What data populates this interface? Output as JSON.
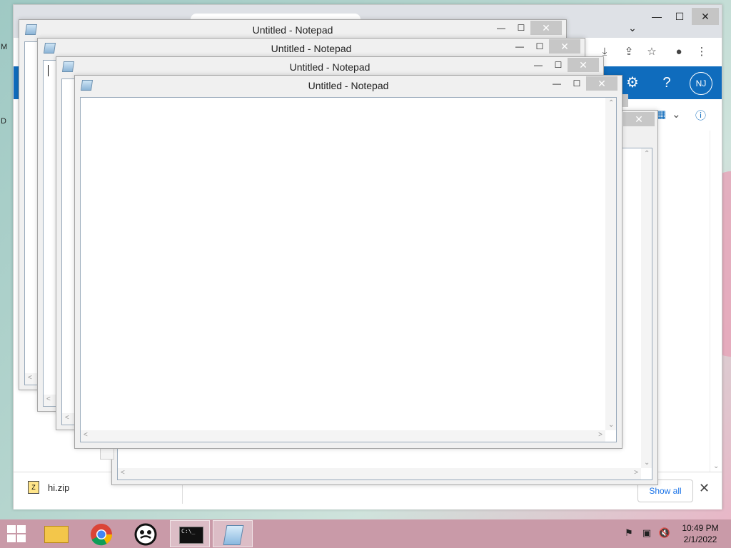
{
  "desktop": {
    "edge_letters": [
      "M",
      "D"
    ]
  },
  "chrome": {
    "window_controls": {
      "minimize": "—",
      "maximize": "☐",
      "close": "✕"
    },
    "tab_dropdown": "⌄",
    "toolbar_icons": [
      "download-icon",
      "share-icon",
      "star-icon",
      "profile-icon",
      "more-icon"
    ],
    "outlook": {
      "header_icons": [
        "gear-icon",
        "help-icon"
      ],
      "help_label": "?",
      "avatar_initials": "NJ",
      "sub_icons": [
        "layout-icon",
        "chevron-down-icon",
        "info-icon"
      ]
    },
    "download_bar": {
      "file_name": "hi.zip",
      "show_all_label": "Show all",
      "close_label": "✕"
    }
  },
  "notepad": {
    "title": "Untitled - Notepad",
    "minimize": "—",
    "maximize": "☐",
    "close": "✕"
  },
  "taskbar": {
    "items": [
      "file-explorer",
      "chrome",
      "agent-app",
      "command-prompt",
      "notepad"
    ],
    "time": "10:49 PM",
    "date": "2/1/2022",
    "tray_icons": [
      "action-center-flag-icon",
      "network-icon",
      "volume-muted-icon"
    ]
  },
  "colors": {
    "outlook_blue": "#0f6cbd",
    "taskbar": "#c99aa8",
    "close_button_inactive": "#c7c7c7"
  }
}
